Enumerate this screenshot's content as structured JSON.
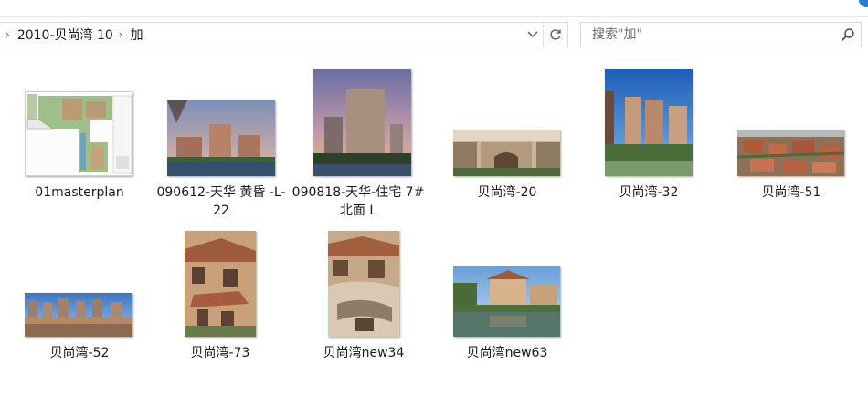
{
  "breadcrumb": [
    "2010-贝尚湾 10",
    "加"
  ],
  "search": {
    "placeholder": "搜索\"加\""
  },
  "files": [
    {
      "label": "01masterplan",
      "thumb": "site-plan"
    },
    {
      "label": "090612-天华 黄昏 -L-22",
      "thumb": "towers-dusk"
    },
    {
      "label": "090818-天华-住宅 7#北面 L",
      "thumb": "tower-sunset"
    },
    {
      "label": "贝尚湾-20",
      "thumb": "entrance"
    },
    {
      "label": "贝尚湾-32",
      "thumb": "towers-day"
    },
    {
      "label": "贝尚湾-51",
      "thumb": "aerial-villas"
    },
    {
      "label": "贝尚湾-52",
      "thumb": "panorama"
    },
    {
      "label": "贝尚湾-73",
      "thumb": "villa-facade"
    },
    {
      "label": "贝尚湾new34",
      "thumb": "villa-courtyard"
    },
    {
      "label": "贝尚湾new63",
      "thumb": "villa-water"
    }
  ]
}
